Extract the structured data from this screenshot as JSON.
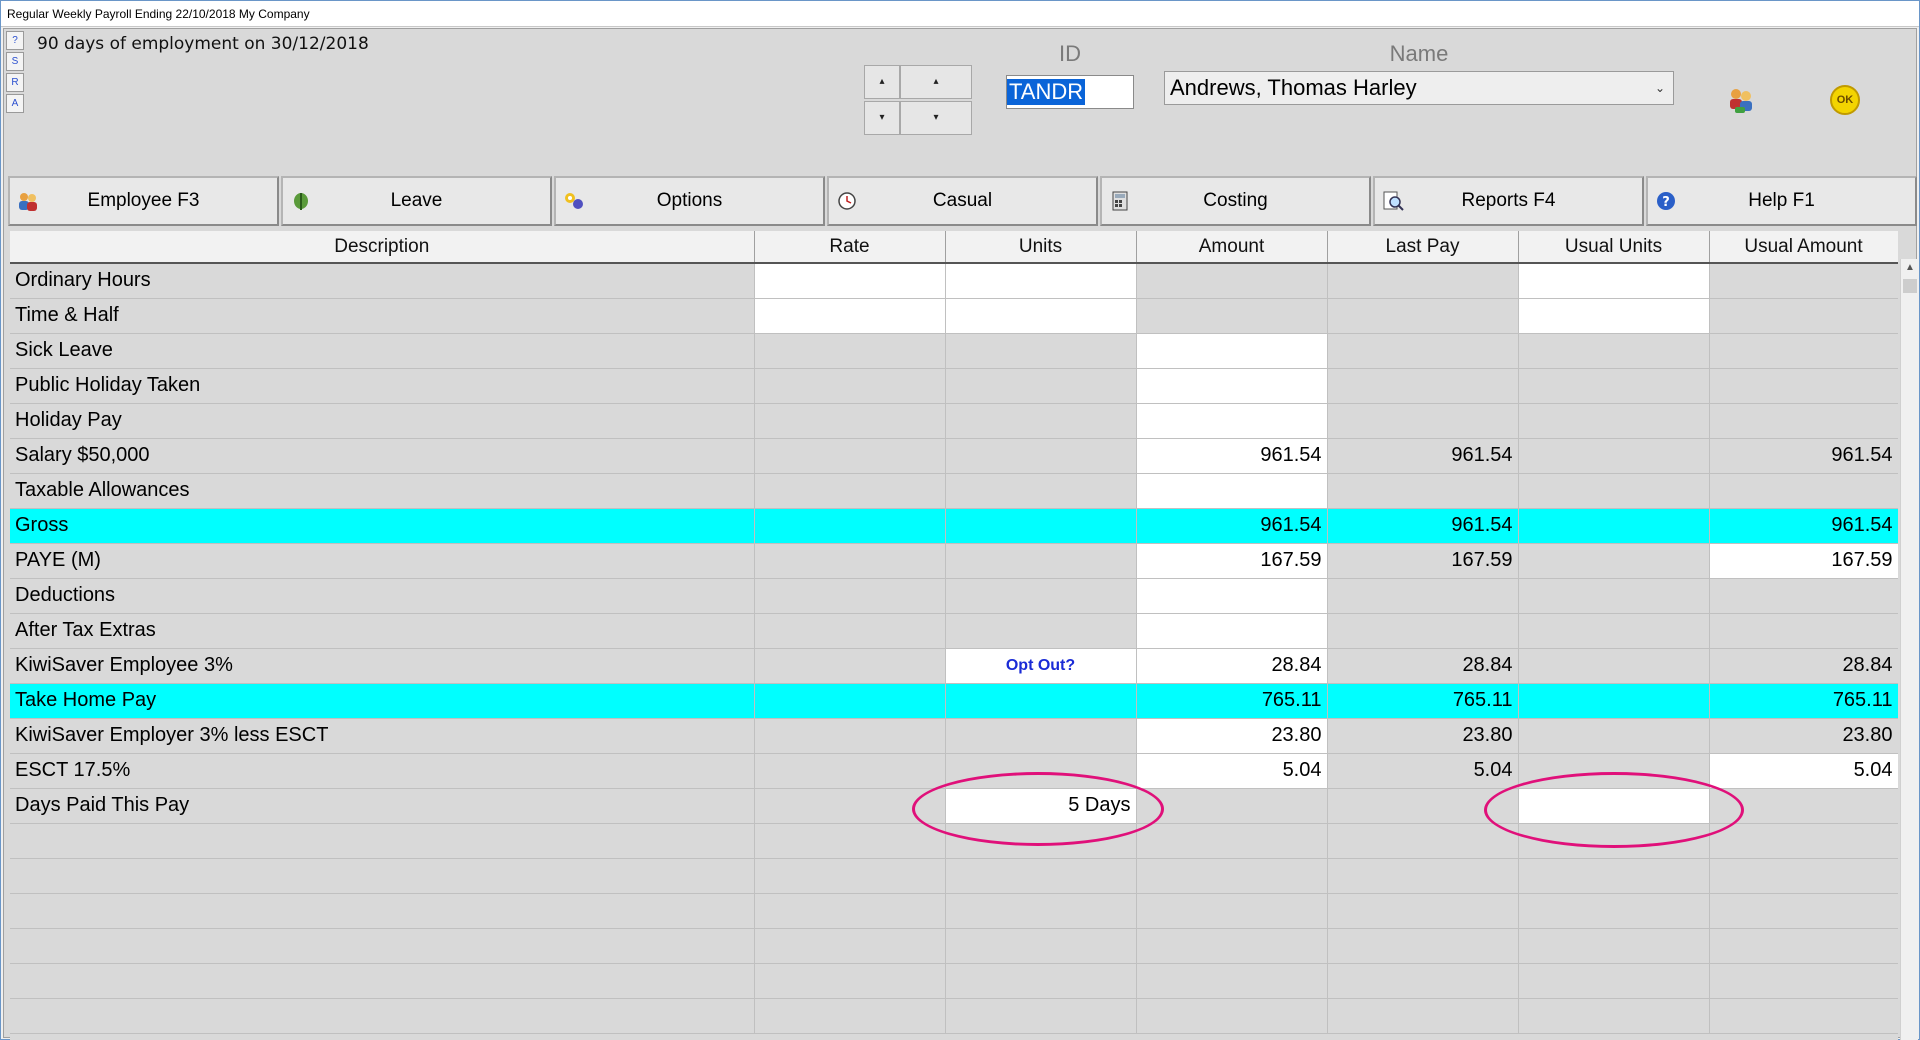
{
  "window": {
    "title": "Regular Weekly Payroll Ending 22/10/2018 My Company"
  },
  "side_buttons": [
    "?",
    "S",
    "R",
    "A"
  ],
  "notice": "90 days of employment on 30/12/2018",
  "nav": {
    "first": "▴",
    "prev": "▴",
    "next": "▾",
    "last": "▾"
  },
  "id_field": {
    "label": "ID",
    "value": "TANDR"
  },
  "name_field": {
    "label": "Name",
    "value": "Andrews, Thomas Harley"
  },
  "ok_label": "OK",
  "tabs": [
    {
      "label": "Employee F3",
      "icon": "people-icon"
    },
    {
      "label": "Leave",
      "icon": "leaf-icon"
    },
    {
      "label": "Options",
      "icon": "options-icon"
    },
    {
      "label": "Casual",
      "icon": "clock-icon"
    },
    {
      "label": "Costing",
      "icon": "calculator-icon"
    },
    {
      "label": "Reports F4",
      "icon": "magnifier-icon"
    },
    {
      "label": "Help F1",
      "icon": "help-icon"
    }
  ],
  "columns": [
    "Description",
    "Rate",
    "Units",
    "Amount",
    "Last Pay",
    "Usual Units",
    "Usual Amount"
  ],
  "rows": [
    {
      "description": "Ordinary Hours",
      "rate": "",
      "units": "",
      "amount": "",
      "last_pay": "",
      "usual_units": "",
      "usual_amount": ""
    },
    {
      "description": "Time & Half",
      "rate": "",
      "units": "",
      "amount": "",
      "last_pay": "",
      "usual_units": "",
      "usual_amount": ""
    },
    {
      "description": "Sick Leave",
      "rate": "",
      "units": "",
      "amount": "",
      "last_pay": "",
      "usual_units": "",
      "usual_amount": ""
    },
    {
      "description": "Public Holiday Taken",
      "rate": "",
      "units": "",
      "amount": "",
      "last_pay": "",
      "usual_units": "",
      "usual_amount": ""
    },
    {
      "description": "Holiday Pay",
      "rate": "",
      "units": "",
      "amount": "",
      "last_pay": "",
      "usual_units": "",
      "usual_amount": ""
    },
    {
      "description": "Salary $50,000",
      "rate": "",
      "units": "",
      "amount": "961.54",
      "last_pay": "961.54",
      "usual_units": "",
      "usual_amount": "961.54"
    },
    {
      "description": "Taxable Allowances",
      "rate": "",
      "units": "",
      "amount": "",
      "last_pay": "",
      "usual_units": "",
      "usual_amount": ""
    },
    {
      "description": "Gross",
      "rate": "",
      "units": "",
      "amount": "961.54",
      "last_pay": "961.54",
      "usual_units": "",
      "usual_amount": "961.54"
    },
    {
      "description": "PAYE (M)",
      "rate": "",
      "units": "",
      "amount": "167.59",
      "last_pay": "167.59",
      "usual_units": "",
      "usual_amount": "167.59"
    },
    {
      "description": "Deductions",
      "rate": "",
      "units": "",
      "amount": "",
      "last_pay": "",
      "usual_units": "",
      "usual_amount": ""
    },
    {
      "description": "After Tax Extras",
      "rate": "",
      "units": "",
      "amount": "",
      "last_pay": "",
      "usual_units": "",
      "usual_amount": ""
    },
    {
      "description": "KiwiSaver Employee 3%",
      "rate": "",
      "units": "Opt Out?",
      "amount": "28.84",
      "last_pay": "28.84",
      "usual_units": "",
      "usual_amount": "28.84"
    },
    {
      "description": "Take Home Pay",
      "rate": "",
      "units": "",
      "amount": "765.11",
      "last_pay": "765.11",
      "usual_units": "",
      "usual_amount": "765.11"
    },
    {
      "description": "KiwiSaver Employer 3%  less ESCT",
      "rate": "",
      "units": "",
      "amount": "23.80",
      "last_pay": "23.80",
      "usual_units": "",
      "usual_amount": "23.80"
    },
    {
      "description": "ESCT 17.5%",
      "rate": "",
      "units": "",
      "amount": "5.04",
      "last_pay": "5.04",
      "usual_units": "",
      "usual_amount": "5.04"
    },
    {
      "description": "Days Paid This Pay",
      "rate": "",
      "units": "5 Days",
      "amount": "",
      "last_pay": "",
      "usual_units": "",
      "usual_amount": ""
    }
  ],
  "colors": {
    "highlight": "#00ffff",
    "annotation": "#e0107a",
    "selection": "#0a64d8"
  }
}
